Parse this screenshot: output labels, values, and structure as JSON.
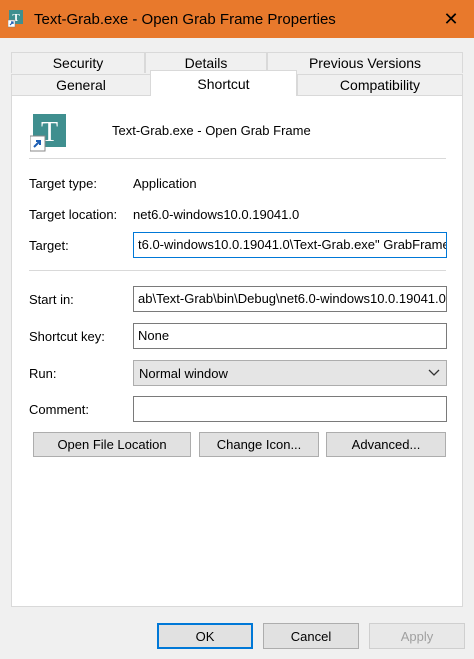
{
  "window": {
    "title": "Text-Grab.exe - Open Grab Frame Properties",
    "close_glyph": "✕"
  },
  "tabs_row1": [
    {
      "label": "Security"
    },
    {
      "label": "Details"
    },
    {
      "label": "Previous Versions"
    }
  ],
  "tabs_row2": [
    {
      "label": "General"
    },
    {
      "label": "Shortcut"
    },
    {
      "label": "Compatibility"
    }
  ],
  "active_tab": "Shortcut",
  "shortcut": {
    "name": "Text-Grab.exe - Open Grab Frame",
    "app_icon_letter": "T",
    "target_type_label": "Target type:",
    "target_type_value": "Application",
    "target_location_label": "Target location:",
    "target_location_value": "net6.0-windows10.0.19041.0",
    "target_label": "Target:",
    "target_value": "t6.0-windows10.0.19041.0\\Text-Grab.exe\" GrabFrame",
    "start_in_label": "Start in:",
    "start_in_value": "ab\\Text-Grab\\bin\\Debug\\net6.0-windows10.0.19041.0\"",
    "shortcut_key_label": "Shortcut key:",
    "shortcut_key_value": "None",
    "run_label": "Run:",
    "run_value": "Normal window",
    "comment_label": "Comment:",
    "comment_value": "",
    "open_file_location_label": "Open File Location",
    "change_icon_label": "Change Icon...",
    "advanced_label": "Advanced..."
  },
  "footer": {
    "ok_label": "OK",
    "cancel_label": "Cancel",
    "apply_label": "Apply"
  },
  "colors": {
    "titlebar": "#e8792c",
    "accent": "#0078d7",
    "icon_teal": "#3f8f8f"
  }
}
